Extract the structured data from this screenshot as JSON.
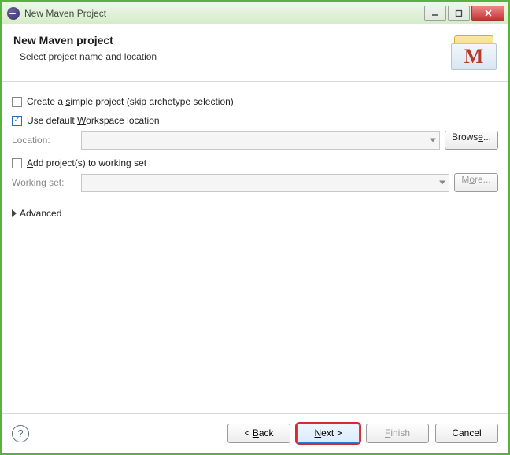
{
  "window": {
    "title": "New Maven Project"
  },
  "header": {
    "title": "New Maven project",
    "subtitle": "Select project name and location",
    "banner_letter": "M"
  },
  "form": {
    "simple_project": {
      "checked": false,
      "label_pre": "Create a ",
      "label_mnemonic": "s",
      "label_post": "imple project (skip archetype selection)"
    },
    "default_workspace": {
      "checked": true,
      "label_pre": "Use default ",
      "label_mnemonic": "W",
      "label_post": "orkspace location"
    },
    "location": {
      "label": "Location:",
      "value": "",
      "browse_pre": "Brows",
      "browse_mnemonic": "e",
      "browse_post": "..."
    },
    "add_to_ws": {
      "checked": false,
      "label_mnemonic": "A",
      "label_post": "dd project(s) to working set"
    },
    "working_set": {
      "label": "Working set:",
      "value": "",
      "more_label_pre": "M",
      "more_label_mnemonic": "o",
      "more_label_post": "re..."
    },
    "advanced_label": "Advanced"
  },
  "footer": {
    "back_pre": "< ",
    "back_mnemonic": "B",
    "back_post": "ack",
    "next_pre": "",
    "next_mnemonic": "N",
    "next_post": "ext >",
    "finish_pre": "",
    "finish_mnemonic": "F",
    "finish_post": "inish",
    "cancel": "Cancel"
  }
}
